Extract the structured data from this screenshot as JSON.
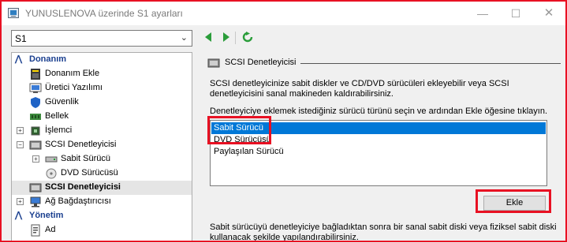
{
  "window": {
    "title": "YUNUSLENOVA üzerinde S1 ayarları",
    "minimize": "—",
    "maximize": "☐",
    "close": "✕"
  },
  "toolbar": {
    "vm_selected": "S1"
  },
  "tree": {
    "sections": [
      {
        "title": "Donanım",
        "items": [
          {
            "label": "Donanım Ekle",
            "icon": "add-hardware-icon",
            "level": 1
          },
          {
            "label": "Üretici Yazılımı",
            "icon": "firmware-icon",
            "level": 1
          },
          {
            "label": "Güvenlik",
            "icon": "shield-icon",
            "level": 1
          },
          {
            "label": "Bellek",
            "icon": "memory-icon",
            "level": 1
          },
          {
            "label": "İşlemci",
            "icon": "processor-icon",
            "level": 1,
            "expander": "+"
          },
          {
            "label": "SCSI Denetleyicisi",
            "icon": "scsi-controller-icon",
            "level": 1,
            "expander": "−"
          },
          {
            "label": "Sabit Sürücü",
            "icon": "hard-drive-icon",
            "level": 2,
            "expander": "+"
          },
          {
            "label": "DVD Sürücüsü",
            "icon": "dvd-icon",
            "level": 2
          },
          {
            "label": "SCSI Denetleyicisi",
            "icon": "scsi-controller-icon",
            "level": 1,
            "selected": true
          },
          {
            "label": "Ağ Bağdaştırıcısı",
            "icon": "network-adapter-icon",
            "level": 1,
            "expander": "+"
          }
        ]
      },
      {
        "title": "Yönetim",
        "items": [
          {
            "label": "Ad",
            "icon": "name-icon",
            "level": 1
          }
        ]
      }
    ]
  },
  "panel": {
    "section_title": "SCSI Denetleyicisi",
    "description": "SCSI denetleyicinize sabit diskler ve CD/DVD sürücüleri ekleyebilir veya SCSI denetleyicisini sanal makineden kaldırabilirsiniz.",
    "instruction": "Denetleyiciye eklemek istediğiniz sürücü türünü seçin ve ardından Ekle öğesine tıklayın.",
    "drive_types": [
      "Sabit Sürücü",
      "DVD Sürücüsü",
      "Paylaşılan Sürücü"
    ],
    "selected_index": 0,
    "add_button": "Ekle",
    "footer_text": "Sabit sürücüyü denetleyiciye bağladıktan sonra bir sanal sabit diski veya fiziksel sabit diski kullanacak şekilde yapılandırabilirsiniz."
  },
  "colors": {
    "highlight": "#e81123",
    "selection": "#0078d7",
    "category_text": "#1a3f8f",
    "nav_arrow": "#2a9d3a"
  }
}
